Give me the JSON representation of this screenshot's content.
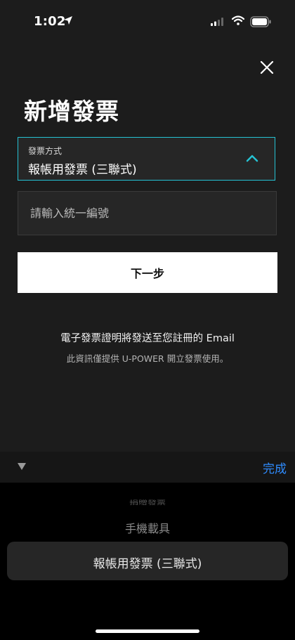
{
  "status_bar": {
    "time": "1:02",
    "icons": [
      "location-arrow-icon",
      "cellular-signal-icon",
      "wifi-icon",
      "battery-icon"
    ]
  },
  "header": {
    "close_icon": "close-icon",
    "title": "新增發票"
  },
  "form": {
    "invoice_type": {
      "label": "發票方式",
      "value": "報帳用發票 (三聯式)",
      "expanded": true
    },
    "tax_id": {
      "placeholder": "請輸入統一編號",
      "value": ""
    },
    "next_label": "下一步"
  },
  "info": {
    "main": "電子發票證明將發送至您註冊的 Email",
    "sub": "此資訊僅提供 U-POWER 開立發票使用。"
  },
  "picker": {
    "done_label": "完成",
    "items": [
      "捐贈發票",
      "手機載具",
      "報帳用發票 (三聯式)"
    ],
    "selected_index": 2
  },
  "colors": {
    "background": "#1c1c1c",
    "accent": "#25c2d3",
    "done_blue": "#2f8cff"
  }
}
